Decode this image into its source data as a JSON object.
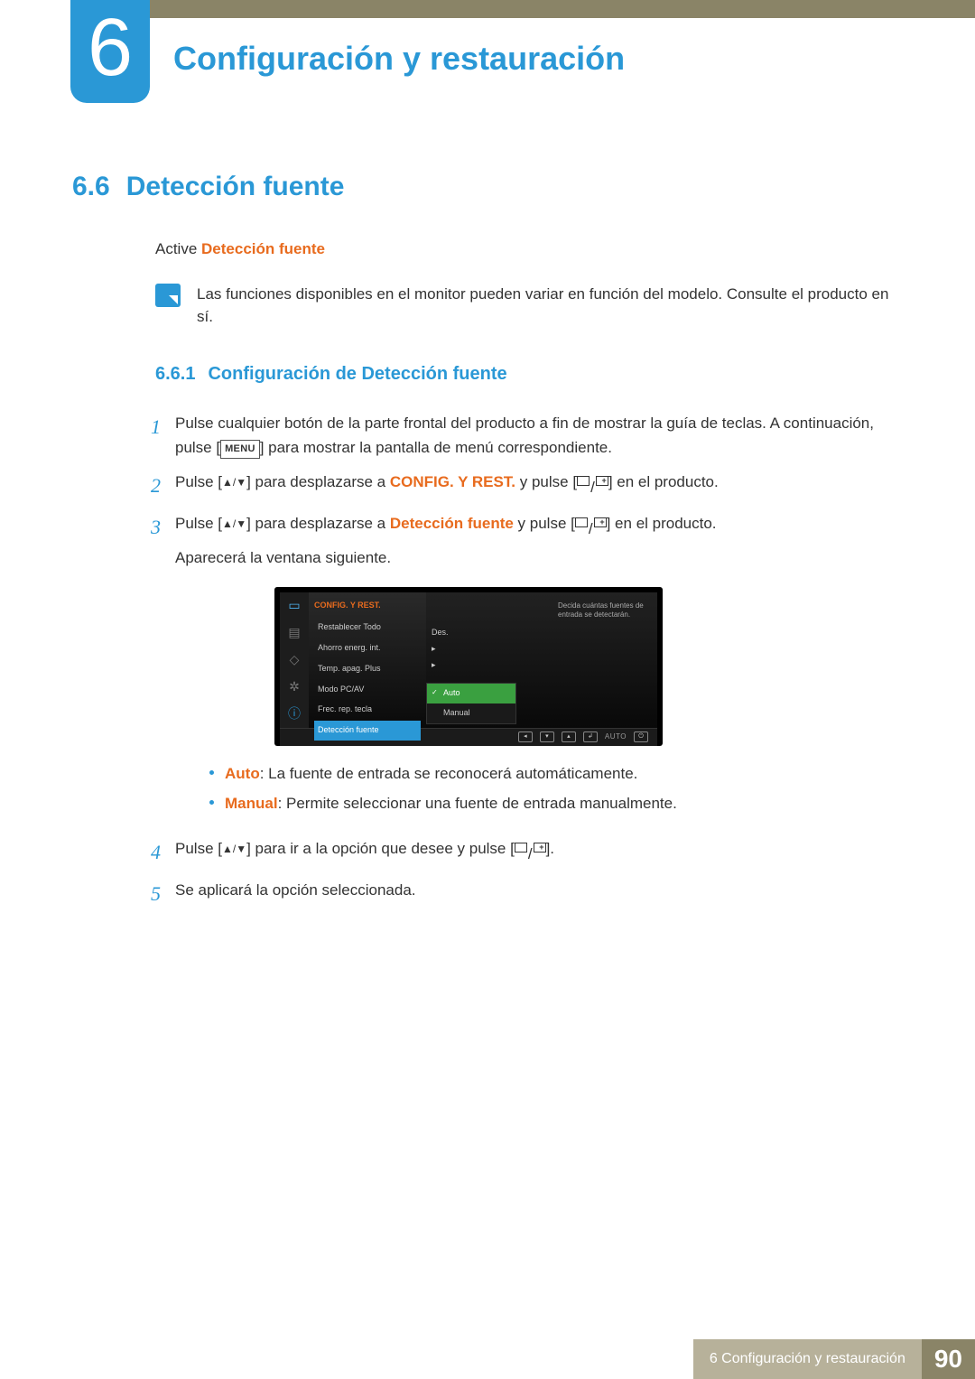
{
  "chapter": {
    "number": "6",
    "title": "Configuración y restauración"
  },
  "section": {
    "number": "6.6",
    "title": "Detección fuente",
    "intro_prefix": "Active ",
    "intro_highlight": "Detección fuente",
    "note": "Las funciones disponibles en el monitor pueden variar en función del modelo. Consulte el producto en sí."
  },
  "subsection": {
    "number": "6.6.1",
    "title": "Configuración de Detección fuente"
  },
  "steps": {
    "s1a": "Pulse cualquier botón de la parte frontal del producto a fin de mostrar la guía de teclas. A continuación, pulse [",
    "s1_menu": "MENU",
    "s1b": "] para mostrar la pantalla de menú correspondiente.",
    "s2a": "Pulse [",
    "s2b": "] para desplazarse a ",
    "s2_hl": "CONFIG. Y REST.",
    "s2c": " y pulse [",
    "s2d": "] en el producto.",
    "s3a": "Pulse [",
    "s3b": "] para desplazarse a ",
    "s3_hl": "Detección fuente",
    "s3c": " y pulse [",
    "s3d": "] en el producto.",
    "s3e": "Aparecerá la ventana siguiente.",
    "s4a": "Pulse [",
    "s4b": "] para ir a la opción que desee y pulse [",
    "s4c": "].",
    "s5": "Se aplicará la opción seleccionada."
  },
  "osd": {
    "title": "CONFIG. Y REST.",
    "items": [
      {
        "label": "Restablecer Todo",
        "val": ""
      },
      {
        "label": "Ahorro energ. int.",
        "val": "Des."
      },
      {
        "label": "Temp. apag. Plus",
        "val": "▸"
      },
      {
        "label": "Modo PC/AV",
        "val": "▸"
      },
      {
        "label": "Frec. rep. tecla",
        "val": ""
      },
      {
        "label": "Detección fuente",
        "val": ""
      }
    ],
    "hint": "Decida cuántas fuentes de entrada se detectarán.",
    "options": {
      "auto": "Auto",
      "manual": "Manual"
    },
    "footer_auto": "AUTO"
  },
  "bullets": {
    "auto_label": "Auto",
    "auto_text": ": La fuente de entrada se reconocerá automáticamente.",
    "manual_label": "Manual",
    "manual_text": ": Permite seleccionar una fuente de entrada manualmente."
  },
  "footer": {
    "text": "6 Configuración y restauración",
    "page": "90"
  }
}
